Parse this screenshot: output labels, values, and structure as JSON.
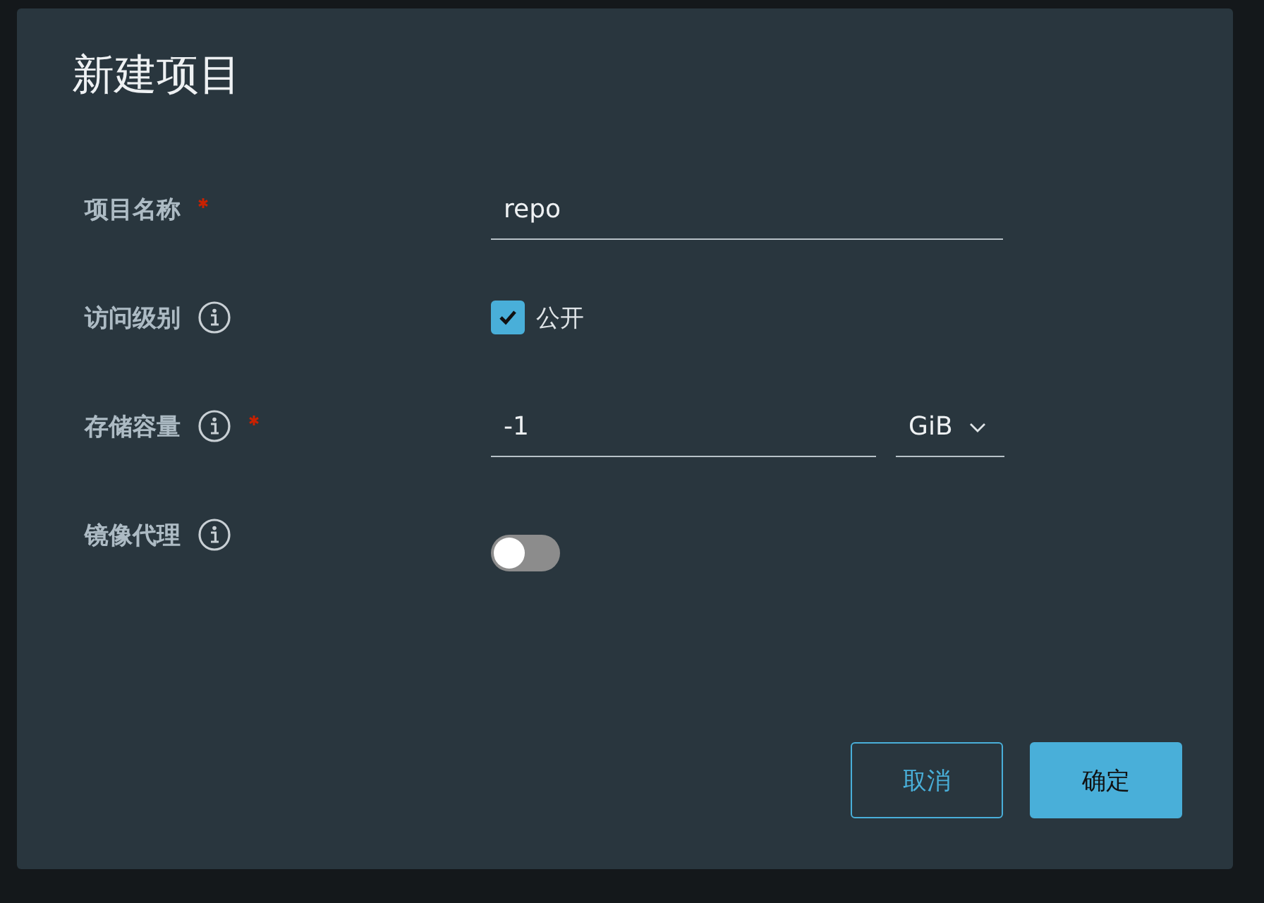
{
  "dialog": {
    "title": "新建项目",
    "fields": [
      {
        "kind": "text",
        "label": "项目名称",
        "required": true,
        "info": false,
        "value": "repo"
      },
      {
        "kind": "checkbox",
        "label": "访问级别",
        "required": false,
        "info": true,
        "option": "公开",
        "checked": true
      },
      {
        "kind": "quota",
        "label": "存储容量",
        "required": true,
        "info": true,
        "value": "-1",
        "unit": "GiB"
      },
      {
        "kind": "toggle",
        "label": "镜像代理",
        "required": false,
        "info": true,
        "on": false
      }
    ],
    "buttons": [
      {
        "label": "取消",
        "kind": "secondary"
      },
      {
        "label": "确定",
        "kind": "primary"
      }
    ]
  }
}
